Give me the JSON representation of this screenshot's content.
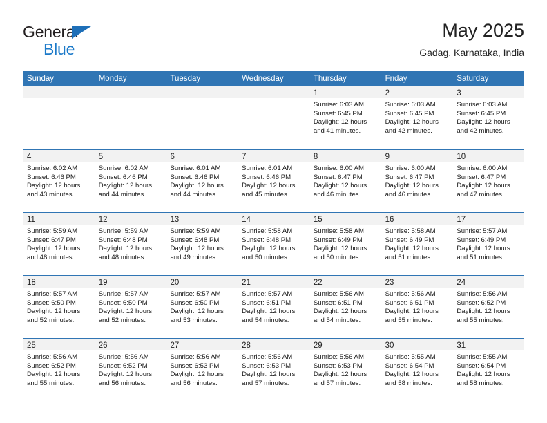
{
  "brand": {
    "name_line1": "General",
    "name_line2": "Blue",
    "accent_color": "#1c7ac9",
    "triangle_color": "#1e6fb8"
  },
  "header": {
    "title": "May 2025",
    "subtitle": "Gadag, Karnataka, India"
  },
  "calendar": {
    "header_bg": "#3075b4",
    "daynum_bg": "#f2f2f2",
    "weekdays": [
      "Sunday",
      "Monday",
      "Tuesday",
      "Wednesday",
      "Thursday",
      "Friday",
      "Saturday"
    ],
    "weeks": [
      [
        {
          "day": "",
          "sunrise": "",
          "sunset": "",
          "daylight1": "",
          "daylight2": ""
        },
        {
          "day": "",
          "sunrise": "",
          "sunset": "",
          "daylight1": "",
          "daylight2": ""
        },
        {
          "day": "",
          "sunrise": "",
          "sunset": "",
          "daylight1": "",
          "daylight2": ""
        },
        {
          "day": "",
          "sunrise": "",
          "sunset": "",
          "daylight1": "",
          "daylight2": ""
        },
        {
          "day": "1",
          "sunrise": "Sunrise: 6:03 AM",
          "sunset": "Sunset: 6:45 PM",
          "daylight1": "Daylight: 12 hours",
          "daylight2": "and 41 minutes."
        },
        {
          "day": "2",
          "sunrise": "Sunrise: 6:03 AM",
          "sunset": "Sunset: 6:45 PM",
          "daylight1": "Daylight: 12 hours",
          "daylight2": "and 42 minutes."
        },
        {
          "day": "3",
          "sunrise": "Sunrise: 6:03 AM",
          "sunset": "Sunset: 6:45 PM",
          "daylight1": "Daylight: 12 hours",
          "daylight2": "and 42 minutes."
        }
      ],
      [
        {
          "day": "4",
          "sunrise": "Sunrise: 6:02 AM",
          "sunset": "Sunset: 6:46 PM",
          "daylight1": "Daylight: 12 hours",
          "daylight2": "and 43 minutes."
        },
        {
          "day": "5",
          "sunrise": "Sunrise: 6:02 AM",
          "sunset": "Sunset: 6:46 PM",
          "daylight1": "Daylight: 12 hours",
          "daylight2": "and 44 minutes."
        },
        {
          "day": "6",
          "sunrise": "Sunrise: 6:01 AM",
          "sunset": "Sunset: 6:46 PM",
          "daylight1": "Daylight: 12 hours",
          "daylight2": "and 44 minutes."
        },
        {
          "day": "7",
          "sunrise": "Sunrise: 6:01 AM",
          "sunset": "Sunset: 6:46 PM",
          "daylight1": "Daylight: 12 hours",
          "daylight2": "and 45 minutes."
        },
        {
          "day": "8",
          "sunrise": "Sunrise: 6:00 AM",
          "sunset": "Sunset: 6:47 PM",
          "daylight1": "Daylight: 12 hours",
          "daylight2": "and 46 minutes."
        },
        {
          "day": "9",
          "sunrise": "Sunrise: 6:00 AM",
          "sunset": "Sunset: 6:47 PM",
          "daylight1": "Daylight: 12 hours",
          "daylight2": "and 46 minutes."
        },
        {
          "day": "10",
          "sunrise": "Sunrise: 6:00 AM",
          "sunset": "Sunset: 6:47 PM",
          "daylight1": "Daylight: 12 hours",
          "daylight2": "and 47 minutes."
        }
      ],
      [
        {
          "day": "11",
          "sunrise": "Sunrise: 5:59 AM",
          "sunset": "Sunset: 6:47 PM",
          "daylight1": "Daylight: 12 hours",
          "daylight2": "and 48 minutes."
        },
        {
          "day": "12",
          "sunrise": "Sunrise: 5:59 AM",
          "sunset": "Sunset: 6:48 PM",
          "daylight1": "Daylight: 12 hours",
          "daylight2": "and 48 minutes."
        },
        {
          "day": "13",
          "sunrise": "Sunrise: 5:59 AM",
          "sunset": "Sunset: 6:48 PM",
          "daylight1": "Daylight: 12 hours",
          "daylight2": "and 49 minutes."
        },
        {
          "day": "14",
          "sunrise": "Sunrise: 5:58 AM",
          "sunset": "Sunset: 6:48 PM",
          "daylight1": "Daylight: 12 hours",
          "daylight2": "and 50 minutes."
        },
        {
          "day": "15",
          "sunrise": "Sunrise: 5:58 AM",
          "sunset": "Sunset: 6:49 PM",
          "daylight1": "Daylight: 12 hours",
          "daylight2": "and 50 minutes."
        },
        {
          "day": "16",
          "sunrise": "Sunrise: 5:58 AM",
          "sunset": "Sunset: 6:49 PM",
          "daylight1": "Daylight: 12 hours",
          "daylight2": "and 51 minutes."
        },
        {
          "day": "17",
          "sunrise": "Sunrise: 5:57 AM",
          "sunset": "Sunset: 6:49 PM",
          "daylight1": "Daylight: 12 hours",
          "daylight2": "and 51 minutes."
        }
      ],
      [
        {
          "day": "18",
          "sunrise": "Sunrise: 5:57 AM",
          "sunset": "Sunset: 6:50 PM",
          "daylight1": "Daylight: 12 hours",
          "daylight2": "and 52 minutes."
        },
        {
          "day": "19",
          "sunrise": "Sunrise: 5:57 AM",
          "sunset": "Sunset: 6:50 PM",
          "daylight1": "Daylight: 12 hours",
          "daylight2": "and 52 minutes."
        },
        {
          "day": "20",
          "sunrise": "Sunrise: 5:57 AM",
          "sunset": "Sunset: 6:50 PM",
          "daylight1": "Daylight: 12 hours",
          "daylight2": "and 53 minutes."
        },
        {
          "day": "21",
          "sunrise": "Sunrise: 5:57 AM",
          "sunset": "Sunset: 6:51 PM",
          "daylight1": "Daylight: 12 hours",
          "daylight2": "and 54 minutes."
        },
        {
          "day": "22",
          "sunrise": "Sunrise: 5:56 AM",
          "sunset": "Sunset: 6:51 PM",
          "daylight1": "Daylight: 12 hours",
          "daylight2": "and 54 minutes."
        },
        {
          "day": "23",
          "sunrise": "Sunrise: 5:56 AM",
          "sunset": "Sunset: 6:51 PM",
          "daylight1": "Daylight: 12 hours",
          "daylight2": "and 55 minutes."
        },
        {
          "day": "24",
          "sunrise": "Sunrise: 5:56 AM",
          "sunset": "Sunset: 6:52 PM",
          "daylight1": "Daylight: 12 hours",
          "daylight2": "and 55 minutes."
        }
      ],
      [
        {
          "day": "25",
          "sunrise": "Sunrise: 5:56 AM",
          "sunset": "Sunset: 6:52 PM",
          "daylight1": "Daylight: 12 hours",
          "daylight2": "and 55 minutes."
        },
        {
          "day": "26",
          "sunrise": "Sunrise: 5:56 AM",
          "sunset": "Sunset: 6:52 PM",
          "daylight1": "Daylight: 12 hours",
          "daylight2": "and 56 minutes."
        },
        {
          "day": "27",
          "sunrise": "Sunrise: 5:56 AM",
          "sunset": "Sunset: 6:53 PM",
          "daylight1": "Daylight: 12 hours",
          "daylight2": "and 56 minutes."
        },
        {
          "day": "28",
          "sunrise": "Sunrise: 5:56 AM",
          "sunset": "Sunset: 6:53 PM",
          "daylight1": "Daylight: 12 hours",
          "daylight2": "and 57 minutes."
        },
        {
          "day": "29",
          "sunrise": "Sunrise: 5:56 AM",
          "sunset": "Sunset: 6:53 PM",
          "daylight1": "Daylight: 12 hours",
          "daylight2": "and 57 minutes."
        },
        {
          "day": "30",
          "sunrise": "Sunrise: 5:55 AM",
          "sunset": "Sunset: 6:54 PM",
          "daylight1": "Daylight: 12 hours",
          "daylight2": "and 58 minutes."
        },
        {
          "day": "31",
          "sunrise": "Sunrise: 5:55 AM",
          "sunset": "Sunset: 6:54 PM",
          "daylight1": "Daylight: 12 hours",
          "daylight2": "and 58 minutes."
        }
      ]
    ]
  }
}
